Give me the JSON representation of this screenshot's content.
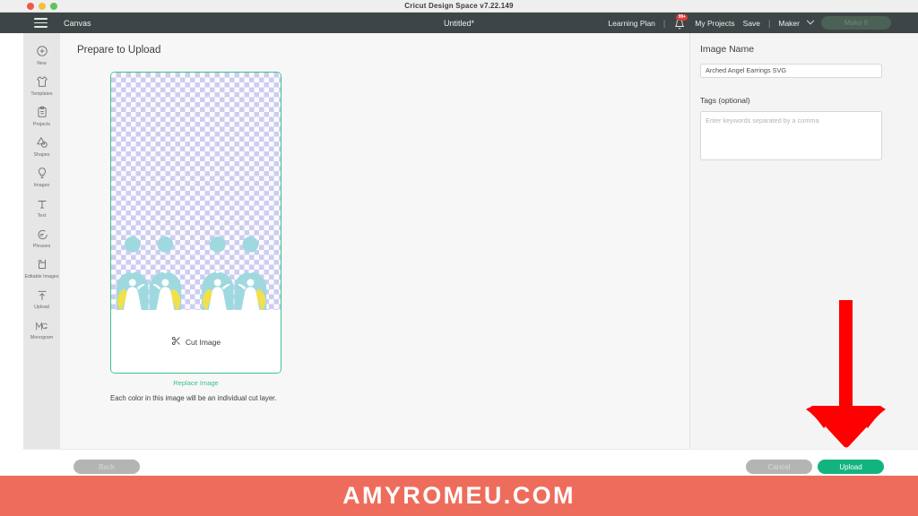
{
  "window": {
    "title": "Cricut Design Space  v7.22.149",
    "traffic_lights": [
      "close-red",
      "minimize-yellow",
      "zoom-green"
    ]
  },
  "appbar": {
    "menu_icon": "hamburger-menu-icon",
    "canvas_label": "Canvas",
    "doc_title": "Untitled*",
    "learning_plan": "Learning Plan",
    "separator": "|",
    "separator2": "|",
    "bell_icon": "notification-bell-icon",
    "bell_badge": "99+",
    "my_projects": "My Projects",
    "save": "Save",
    "machine": "Maker",
    "machine_chevron": "chevron-down-icon",
    "make_it": "Make It"
  },
  "sidebar": {
    "items": [
      {
        "label": "New",
        "icon": "plus-circle-icon"
      },
      {
        "label": "Templates",
        "icon": "tshirt-icon"
      },
      {
        "label": "Projects",
        "icon": "clipboard-icon"
      },
      {
        "label": "Shapes",
        "icon": "shapes-icon"
      },
      {
        "label": "Images",
        "icon": "lightbulb-icon"
      },
      {
        "label": "Text",
        "icon": "text-t-icon"
      },
      {
        "label": "Phrases",
        "icon": "speech-bubble-icon"
      },
      {
        "label": "Editable Images",
        "icon": "editable-images-icon"
      },
      {
        "label": "Upload",
        "icon": "upload-arrow-icon"
      },
      {
        "label": "Monogram",
        "icon": "monogram-icon"
      }
    ]
  },
  "main": {
    "page_title": "Prepare to Upload",
    "cut_image_label": "Cut Image",
    "cut_image_icon": "scissors-icon",
    "replace_image_label": "Replace Image",
    "cut_note": "Each color in this image will be an individual cut layer.",
    "preview": {
      "alt": "arched-angel-earrings-preview",
      "transparency_checker": true,
      "colors": {
        "arch": "#9fd9e0",
        "wing": "#f2e04a",
        "body": "#ffffff",
        "checker_light": "#fbfbff",
        "checker_dark": "#cdcdf0"
      },
      "figure_count": 4
    }
  },
  "right_panel": {
    "image_name_label": "Image Name",
    "image_name_value": "Arched Angel Earrings SVG",
    "tags_label": "Tags (optional)",
    "tags_value": "",
    "tags_placeholder": "Enter keywords separated by a comma"
  },
  "actions": {
    "back": "Back",
    "cancel": "Cancel",
    "upload": "Upload"
  },
  "annotation": {
    "arrow": "red-down-arrow-pointing-to-upload",
    "color": "#fe0000"
  },
  "banner": {
    "text": "AMYROMEU.COM",
    "background": "#ee6c5c",
    "text_color": "#ffffff"
  },
  "theme": {
    "appbar_bg": "#3e4547",
    "rail_bg": "#e6e6e6",
    "workspace_bg": "#f7f7f7",
    "panel_bg": "#f4f4f4",
    "accent_green": "#13b37f",
    "link_green": "#3cc38a"
  }
}
